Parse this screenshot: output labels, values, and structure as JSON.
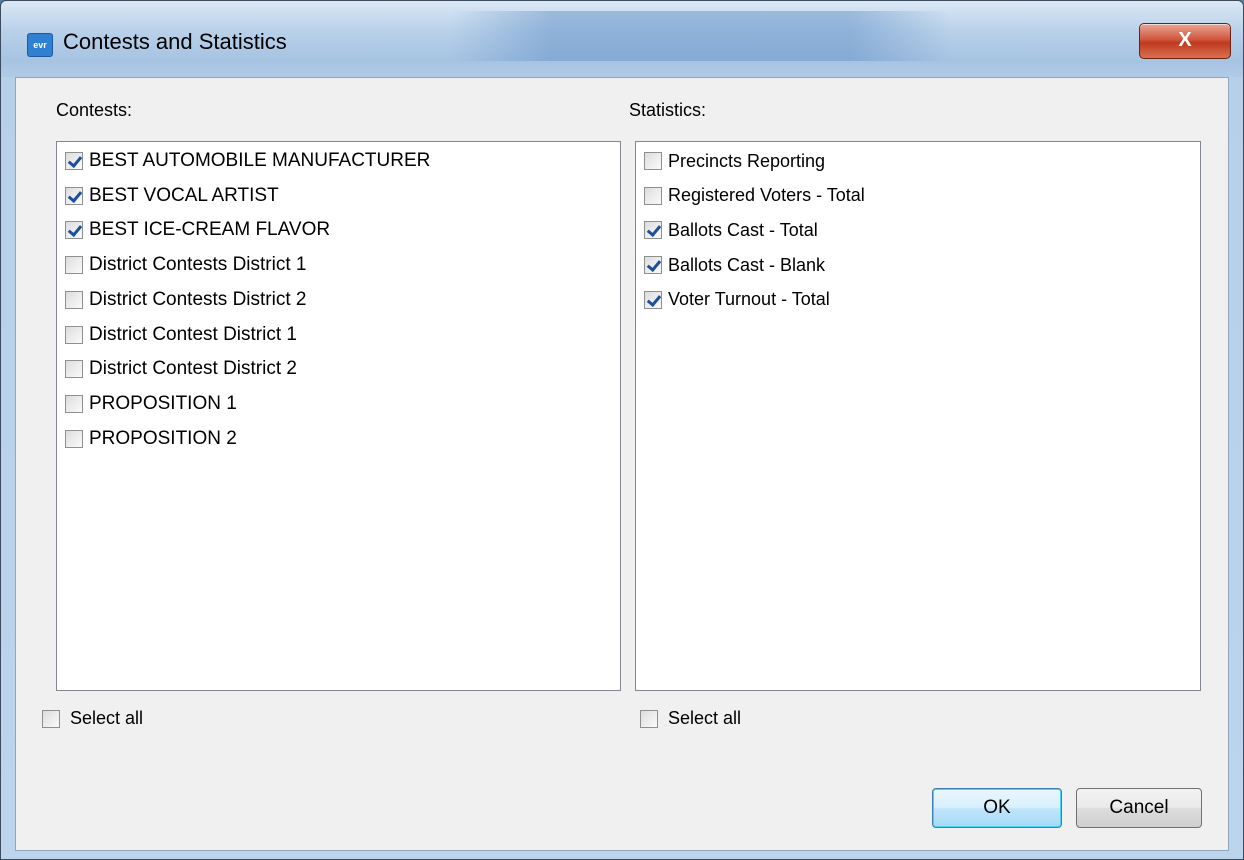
{
  "window": {
    "title": "Contests and Statistics",
    "app_icon_text": "evr",
    "close_glyph": "X"
  },
  "contests": {
    "label": "Contests:",
    "items": [
      {
        "label": "BEST AUTOMOBILE MANUFACTURER",
        "checked": true
      },
      {
        "label": "BEST VOCAL ARTIST",
        "checked": true
      },
      {
        "label": "BEST ICE-CREAM FLAVOR",
        "checked": true
      },
      {
        "label": "District Contests District 1",
        "checked": false
      },
      {
        "label": "District Contests District 2",
        "checked": false
      },
      {
        "label": "District Contest District 1",
        "checked": false
      },
      {
        "label": "District Contest District 2",
        "checked": false
      },
      {
        "label": "PROPOSITION 1",
        "checked": false
      },
      {
        "label": "PROPOSITION 2",
        "checked": false
      }
    ],
    "select_all_label": "Select all",
    "select_all_checked": false
  },
  "statistics": {
    "label": "Statistics:",
    "items": [
      {
        "label": "Precincts Reporting",
        "checked": false
      },
      {
        "label": "Registered Voters - Total",
        "checked": false
      },
      {
        "label": "Ballots Cast - Total",
        "checked": true
      },
      {
        "label": "Ballots Cast - Blank",
        "checked": true
      },
      {
        "label": "Voter Turnout - Total",
        "checked": true
      }
    ],
    "select_all_label": "Select all",
    "select_all_checked": false
  },
  "buttons": {
    "ok": "OK",
    "cancel": "Cancel"
  }
}
